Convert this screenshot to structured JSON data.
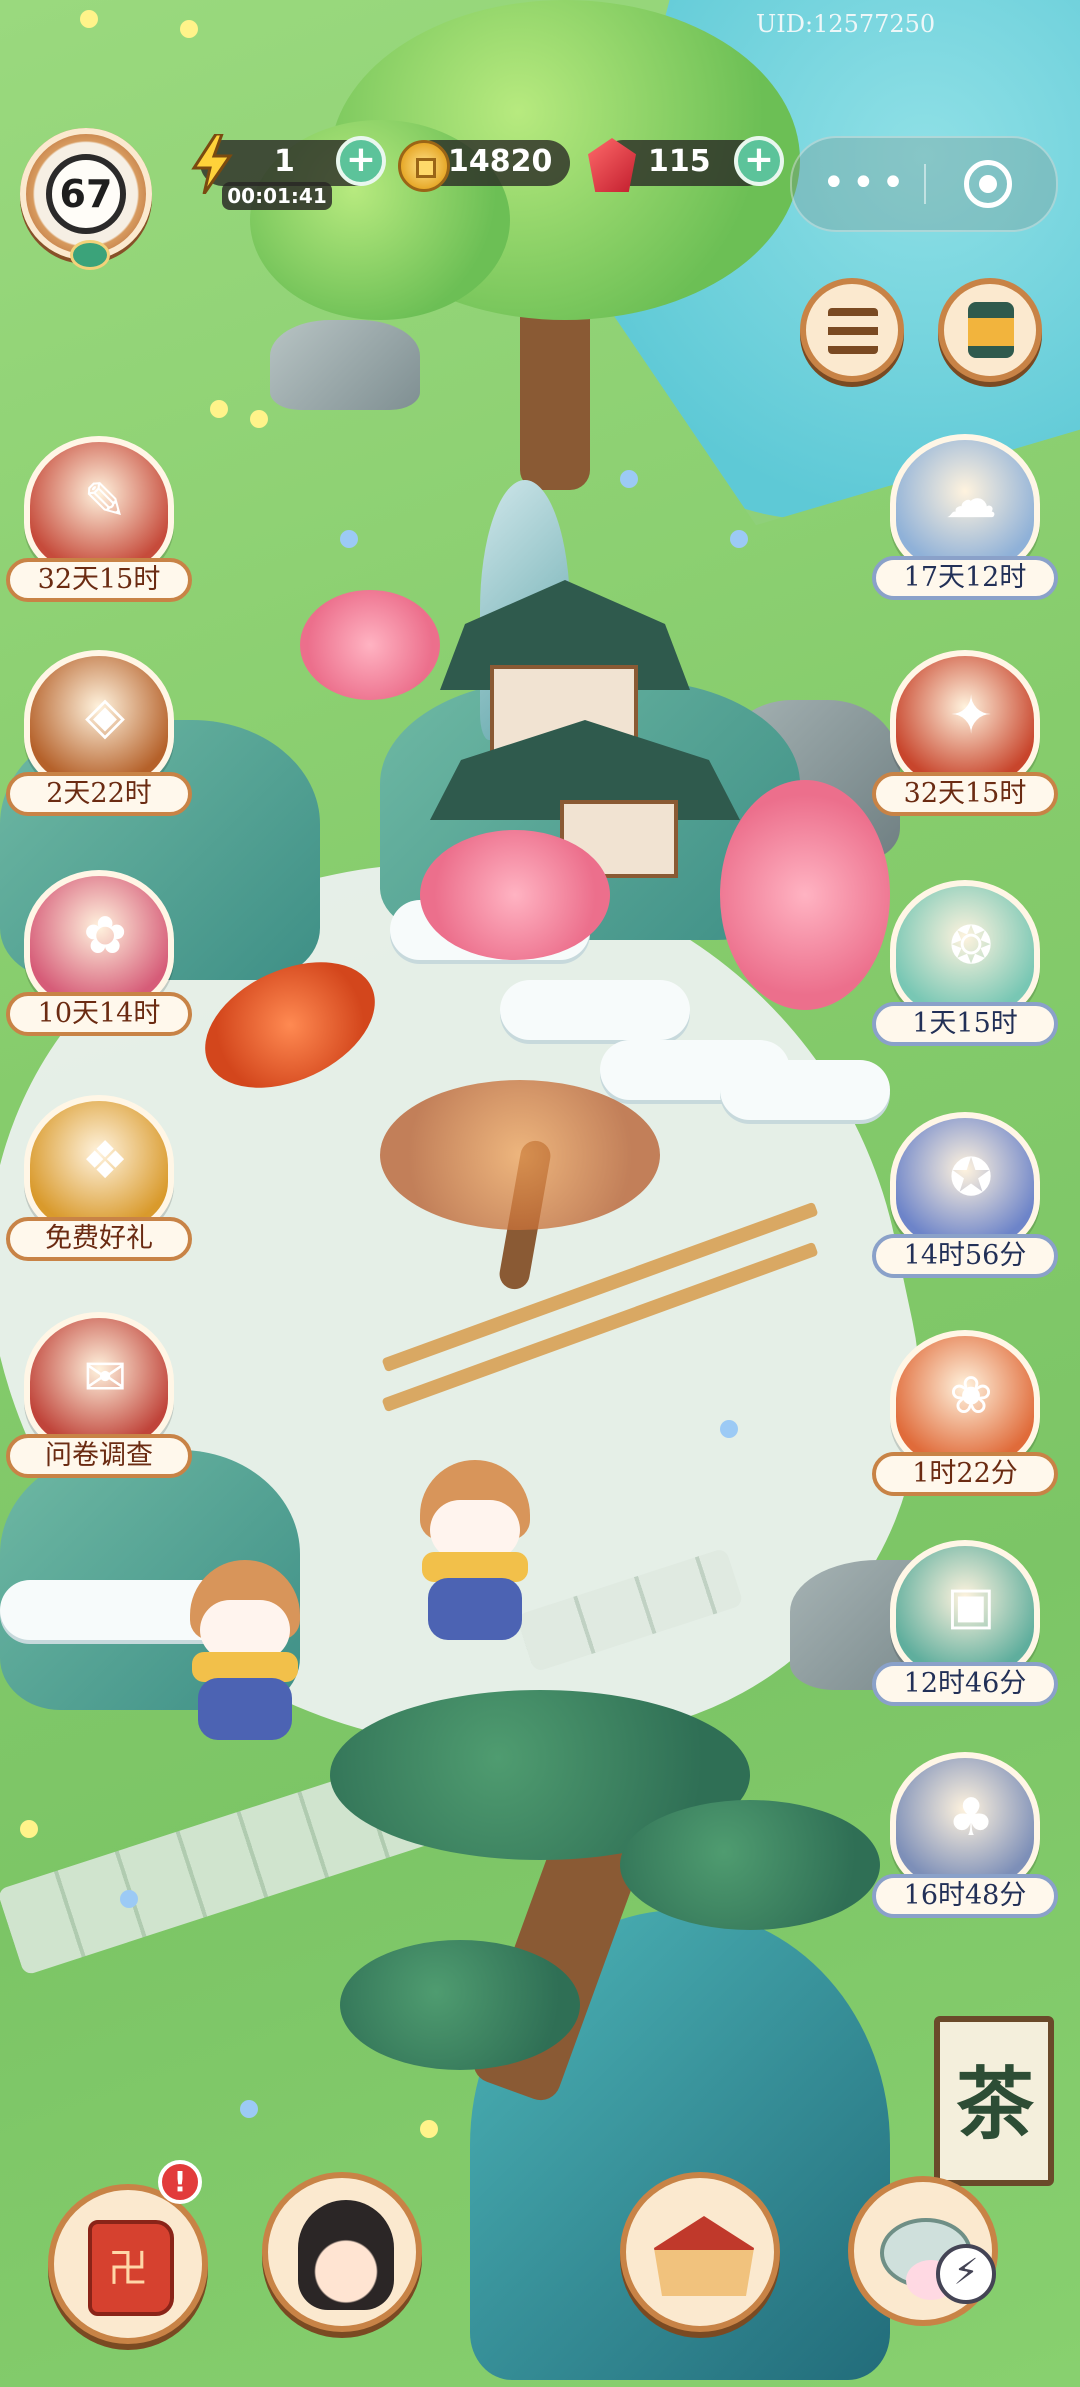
{
  "hud": {
    "uid": "UID:12577250",
    "level": "67",
    "energy": "1",
    "energy_timer": "00:01:41",
    "coins": "14820",
    "gems": "115",
    "plus": "+"
  },
  "capsule": {
    "more": "•••"
  },
  "events_left": [
    {
      "label": "32天15时",
      "icon": "calendar-scroll-icon",
      "color": "#c64b3b"
    },
    {
      "label": "2天22时",
      "icon": "treasure-chest-icon",
      "color": "#b5612a"
    },
    {
      "label": "10天14时",
      "icon": "lion-dance-icon",
      "color": "#d65c78"
    },
    {
      "label": "免费好礼",
      "icon": "gift-pattern-icon",
      "color": "#d99a2c"
    },
    {
      "label": "问卷调查",
      "icon": "survey-scroll-icon",
      "color": "#c0443a"
    }
  ],
  "events_right": [
    {
      "label": "17天12时",
      "icon": "cat-cloud-icon",
      "color": "#8fb1d8",
      "style": "cool"
    },
    {
      "label": "32天15时",
      "icon": "red-envelope-icon",
      "color": "#c8452c",
      "style": "warm"
    },
    {
      "label": "1天15时",
      "icon": "cat-coins-icon",
      "color": "#78c7b4",
      "style": "cool"
    },
    {
      "label": "14时56分",
      "icon": "knot-fan-icon",
      "color": "#6d84c9",
      "style": "cool"
    },
    {
      "label": "1时22分",
      "icon": "gift-box-red-icon",
      "color": "#e06b3a",
      "style": "warm"
    },
    {
      "label": "12时46分",
      "icon": "cat-giftbox-icon",
      "color": "#5fae9d",
      "style": "cool"
    },
    {
      "label": "16时48分",
      "icon": "cards-icon",
      "color": "#7d8fb8",
      "style": "cool"
    }
  ],
  "alert": "!",
  "tea_sign": "茶",
  "colors": {
    "accent_green": "#5cc39a",
    "panel_cream": "#fbe9cf",
    "panel_border": "#c88346",
    "label_text": "#6b2b12"
  }
}
